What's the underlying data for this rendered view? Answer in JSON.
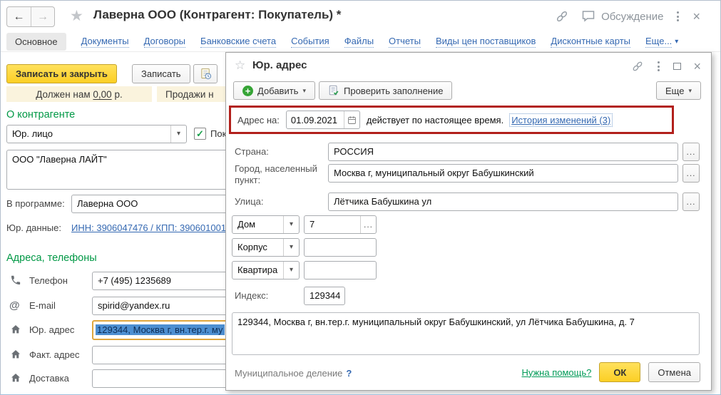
{
  "window": {
    "title": "Лаверна ООО (Контрагент: Покупатель) *",
    "discussion_label": "Обсуждение"
  },
  "tabs": {
    "items": [
      "Основное",
      "Документы",
      "Договоры",
      "Банковские счета",
      "События",
      "Файлы",
      "Отчеты",
      "Виды цен поставщиков",
      "Дисконтные карты",
      "Еще..."
    ]
  },
  "form": {
    "save_close_label": "Записать и закрыть",
    "save_label": "Записать",
    "owed_label": "Должен нам",
    "owed_value": "0,00",
    "owed_currency": "р.",
    "sales_label": "Продажи н",
    "about_heading": "О контрагенте",
    "entity_type_value": "Юр. лицо",
    "checkbox_label": "Пок",
    "company_name": "ООО \"Лаверна ЛАЙТ\"",
    "in_program_label": "В программе:",
    "in_program_value": "Лаверна ООО",
    "legal_data_label": "Юр. данные:",
    "legal_data_link": "ИНН: 3906047476 / КПП: 390601001",
    "addresses_heading": "Адреса, телефоны",
    "rows": [
      {
        "icon": "phone-icon",
        "label": "Телефон",
        "value": "+7 (495) 1235689"
      },
      {
        "icon": "at-icon",
        "label": "E-mail",
        "value": "spirid@yandex.ru"
      },
      {
        "icon": "home-icon",
        "label": "Юр. адрес",
        "value": "129344, Москва г, вн.тер.г. му",
        "selected": true
      },
      {
        "icon": "home-icon",
        "label": "Факт. адрес",
        "value": ""
      },
      {
        "icon": "home-icon",
        "label": "Доставка",
        "value": ""
      }
    ]
  },
  "dialog": {
    "title": "Юр. адрес",
    "add_button": "Добавить",
    "check_button": "Проверить заполнение",
    "more_button": "Еще",
    "address_on_label": "Адрес на:",
    "address_on_date": "01.09.2021",
    "valid_text": "действует по настоящее время.",
    "history_link": "История изменений (3)",
    "fields": {
      "country_label": "Страна:",
      "country_value": "РОССИЯ",
      "city_label": "Город, населенный пункт:",
      "city_value": "Москва г, муниципальный округ Бабушкинский",
      "street_label": "Улица:",
      "street_value": "Лётчика Бабушкина ул",
      "house_label": "Дом",
      "house_value": "7",
      "building_label": "Корпус",
      "building_value": "",
      "apartment_label": "Квартира",
      "apartment_value": "",
      "index_label": "Индекс:",
      "index_value": "129344",
      "full_address": "129344, Москва г, вн.тер.г. муниципальный округ Бабушкинский, ул Лётчика Бабушкина, д. 7"
    },
    "municipal_label": "Муниципальное деление",
    "municipal_help": "?",
    "help_link": "Нужна помощь?",
    "ok_button": "ОК",
    "cancel_button": "Отмена"
  },
  "colors": {
    "accent_yellow": "#fccf25",
    "highlight_red": "#b2201c",
    "heading_green": "#009845",
    "link_blue": "#3569b2",
    "help_green": "#009a57",
    "selection_blue": "#4d8fd1",
    "focus_orange": "#e0a73e"
  }
}
